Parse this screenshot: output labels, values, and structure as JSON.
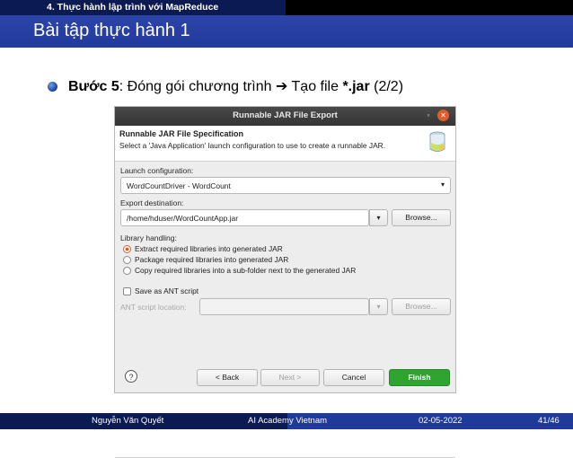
{
  "slide": {
    "section": "4. Thực hành lập trình với MapReduce",
    "title": "Bài tập thực hành 1",
    "bullet": {
      "step": "Bước 5",
      "text": ": Đóng gói chương trình ",
      "arrow": "➔",
      "text2": " Tạo file ",
      "jar": "*.jar",
      "text3": " (2/2)"
    },
    "footer": {
      "author": "Nguyễn Văn Quyết",
      "org": "AI Academy Vietnam",
      "date": "02-05-2022",
      "page": "41/46"
    }
  },
  "dialog": {
    "title": "Runnable JAR File Export",
    "min_glyph": "▫",
    "close_glyph": "✕",
    "spec_title": "Runnable JAR File Specification",
    "spec_desc": "Select a 'Java Application' launch configuration to use to create a runnable JAR.",
    "launch_label": "Launch configuration:",
    "launch_value": "WordCountDriver - WordCount",
    "export_label": "Export destination:",
    "export_value": "/home/hduser/WordCountApp.jar",
    "browse": "Browse...",
    "library_label": "Library handling:",
    "radios": [
      "Extract required libraries into generated JAR",
      "Package required libraries into generated JAR",
      "Copy required libraries into a sub-folder next to the generated JAR"
    ],
    "save_ant": "Save as ANT script",
    "ant_label": "ANT script location:",
    "ant_browse": "Browse...",
    "help": "?",
    "back": "< Back",
    "next": "Next >",
    "cancel": "Cancel",
    "finish": "Finish",
    "colors": {
      "finish": "#2fa52f",
      "radio_on": "#e25c2a"
    }
  }
}
